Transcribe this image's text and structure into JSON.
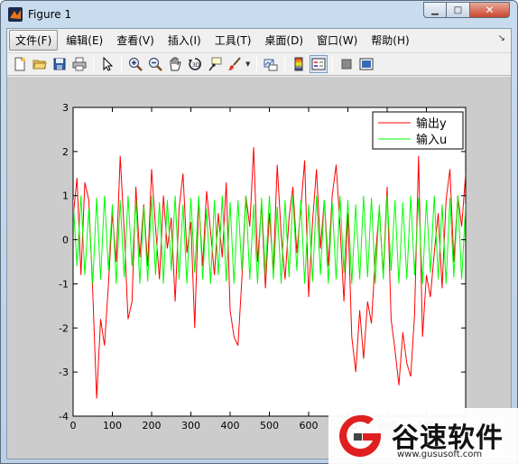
{
  "window": {
    "title": "Figure 1",
    "controls": {
      "minimize": "▁",
      "maximize": "□",
      "close": "✕"
    }
  },
  "menu": {
    "items": [
      "文件(F)",
      "编辑(E)",
      "查看(V)",
      "插入(I)",
      "工具(T)",
      "桌面(D)",
      "窗口(W)",
      "帮助(H)"
    ],
    "overflow_glyph": "↘"
  },
  "toolbar": {
    "icons": [
      "new-figure-icon",
      "open-folder-icon",
      "save-icon",
      "print-icon",
      "pointer-arrow-icon",
      "zoom-in-icon",
      "zoom-out-icon",
      "pan-hand-icon",
      "rotate-3d-icon",
      "data-cursor-icon",
      "brush-icon",
      "link-plot-icon",
      "colorbar-icon",
      "legend-icon",
      "hide-plot-tools-icon",
      "show-plot-tools-icon"
    ]
  },
  "chart_data": {
    "type": "line",
    "title": "",
    "xlabel": "",
    "ylabel": "",
    "xlim": [
      0,
      1000
    ],
    "ylim": [
      -4,
      3
    ],
    "xticks": [
      0,
      100,
      200,
      300,
      400,
      500,
      600,
      700,
      800,
      900
    ],
    "yticks": [
      -4,
      -3,
      -2,
      -1,
      0,
      1,
      2,
      3
    ],
    "grid": false,
    "legend_position": "top-right",
    "series": [
      {
        "name": "输出y",
        "color": "#ff0000",
        "x": [
          0,
          10,
          20,
          30,
          40,
          50,
          60,
          70,
          80,
          90,
          100,
          110,
          120,
          130,
          140,
          150,
          160,
          170,
          180,
          190,
          200,
          210,
          220,
          230,
          240,
          250,
          260,
          270,
          280,
          290,
          300,
          310,
          320,
          330,
          340,
          350,
          360,
          370,
          380,
          390,
          400,
          410,
          420,
          430,
          440,
          450,
          460,
          470,
          480,
          490,
          500,
          510,
          520,
          530,
          540,
          550,
          560,
          570,
          580,
          590,
          600,
          610,
          620,
          630,
          640,
          650,
          660,
          670,
          680,
          690,
          700,
          710,
          720,
          730,
          740,
          750,
          760,
          770,
          780,
          790,
          800,
          810,
          820,
          830,
          840,
          850,
          860,
          870,
          880,
          890,
          900,
          910,
          920,
          930,
          940,
          950,
          960,
          970,
          980,
          990,
          1000
        ],
        "y": [
          0.5,
          1.4,
          -0.8,
          1.3,
          0.9,
          -1.2,
          -3.6,
          -1.8,
          -2.4,
          -1.0,
          0.6,
          -0.5,
          1.9,
          0.2,
          -1.8,
          -1.4,
          1.2,
          -0.4,
          0.8,
          -0.6,
          1.6,
          0.3,
          -0.9,
          1.0,
          -0.2,
          0.5,
          -1.4,
          0.7,
          1.5,
          -0.3,
          0.4,
          -2.0,
          0.9,
          -0.6,
          1.1,
          0.2,
          -0.8,
          0.6,
          -0.4,
          1.3,
          -1.6,
          -2.2,
          -2.4,
          -0.9,
          1.0,
          0.3,
          2.1,
          -0.5,
          0.8,
          -1.1,
          0.6,
          -0.7,
          1.7,
          0.1,
          -0.9,
          0.5,
          1.2,
          -0.3,
          0.7,
          1.8,
          -1.3,
          0.4,
          1.6,
          -0.2,
          0.9,
          -0.6,
          1.0,
          1.7,
          0.3,
          -1.4,
          0.6,
          -2.2,
          -3.0,
          -1.6,
          -2.7,
          -1.4,
          -1.9,
          -0.4,
          0.7,
          -0.8,
          1.2,
          -1.8,
          -2.5,
          -3.3,
          -2.1,
          -2.8,
          -3.1,
          -1.7,
          1.9,
          -2.2,
          -0.8,
          -1.3,
          -0.3,
          0.6,
          -1.1,
          0.9,
          1.6,
          -0.5,
          1.0,
          0.3,
          1.5
        ]
      },
      {
        "name": "输入u",
        "color": "#00ff00",
        "x": [
          0,
          10,
          20,
          30,
          40,
          50,
          60,
          70,
          80,
          90,
          100,
          110,
          120,
          130,
          140,
          150,
          160,
          170,
          180,
          190,
          200,
          210,
          220,
          230,
          240,
          250,
          260,
          270,
          280,
          290,
          300,
          310,
          320,
          330,
          340,
          350,
          360,
          370,
          380,
          390,
          400,
          410,
          420,
          430,
          440,
          450,
          460,
          470,
          480,
          490,
          500,
          510,
          520,
          530,
          540,
          550,
          560,
          570,
          580,
          590,
          600,
          610,
          620,
          630,
          640,
          650,
          660,
          670,
          680,
          690,
          700,
          710,
          720,
          730,
          740,
          750,
          760,
          770,
          780,
          790,
          800,
          810,
          820,
          830,
          840,
          850,
          860,
          870,
          880,
          890,
          900,
          910,
          920,
          930,
          940,
          950,
          960,
          970,
          980,
          990,
          1000
        ],
        "y": [
          0.9,
          -0.6,
          1.0,
          -0.8,
          0.7,
          -1.0,
          0.95,
          -0.9,
          1.0,
          -0.7,
          0.8,
          -1.0,
          0.9,
          -0.85,
          1.0,
          -0.6,
          0.9,
          -1.0,
          0.75,
          -0.95,
          1.0,
          -0.8,
          0.85,
          -1.0,
          0.9,
          -0.7,
          1.0,
          -0.9,
          0.8,
          -1.0,
          0.95,
          -0.75,
          1.0,
          -0.9,
          0.7,
          -1.0,
          0.9,
          -0.8,
          1.0,
          -0.95,
          0.85,
          -1.0,
          0.9,
          -0.7,
          1.0,
          -0.9,
          0.8,
          -1.0,
          0.95,
          -0.8,
          1.0,
          -0.9,
          0.75,
          -1.0,
          0.9,
          -0.85,
          1.0,
          -0.7,
          0.9,
          -1.0,
          0.8,
          -0.95,
          1.0,
          -0.8,
          0.9,
          -1.0,
          0.85,
          -0.9,
          1.0,
          -0.75,
          0.9,
          -1.0,
          0.8,
          -0.9,
          1.0,
          -0.85,
          0.95,
          -1.0,
          0.8,
          -0.9,
          1.0,
          -0.7,
          0.9,
          -1.0,
          0.85,
          -0.9,
          1.0,
          -0.8,
          0.95,
          -1.0,
          0.9,
          -0.75,
          1.0,
          -0.9,
          0.8,
          -1.0,
          0.95,
          -0.85,
          1.0,
          -0.9,
          0.8
        ]
      }
    ]
  },
  "watermark": {
    "name": "谷速软件",
    "url": "www.gususoft.com",
    "brand_colors": {
      "red": "#e02020",
      "grey": "#444444"
    }
  }
}
